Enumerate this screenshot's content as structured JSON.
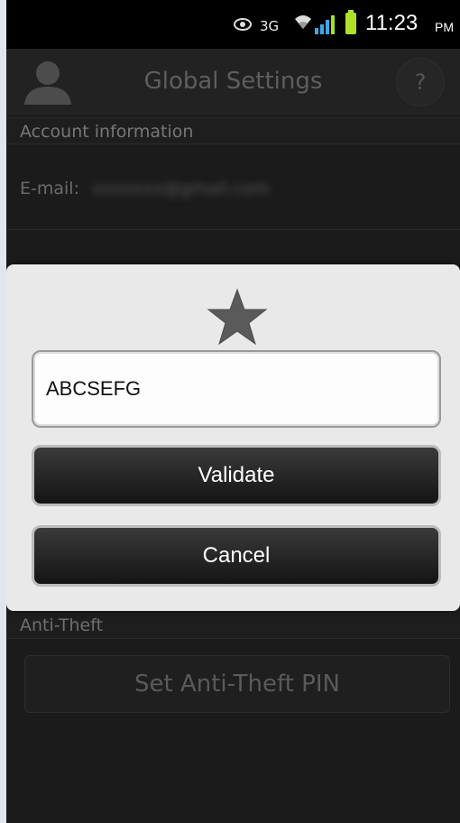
{
  "status_bar": {
    "network": "3G",
    "time": "11:23",
    "ampm": "PM",
    "icons": [
      "eye-icon",
      "wifi-icon",
      "signal-icon",
      "battery-icon"
    ],
    "battery_color": "#aee02a"
  },
  "header": {
    "title": "Global Settings",
    "help_label": "?"
  },
  "account": {
    "section_title": "Account information",
    "email_label": "E-mail:",
    "email_value": "xxxxxxx@gmail.com"
  },
  "anti_theft": {
    "section_title": "Anti-Theft",
    "set_pin_label": "Set Anti-Theft PIN"
  },
  "dialog": {
    "icon": "star-icon",
    "input_value": "ABCSEFG",
    "validate_label": "Validate",
    "cancel_label": "Cancel"
  }
}
